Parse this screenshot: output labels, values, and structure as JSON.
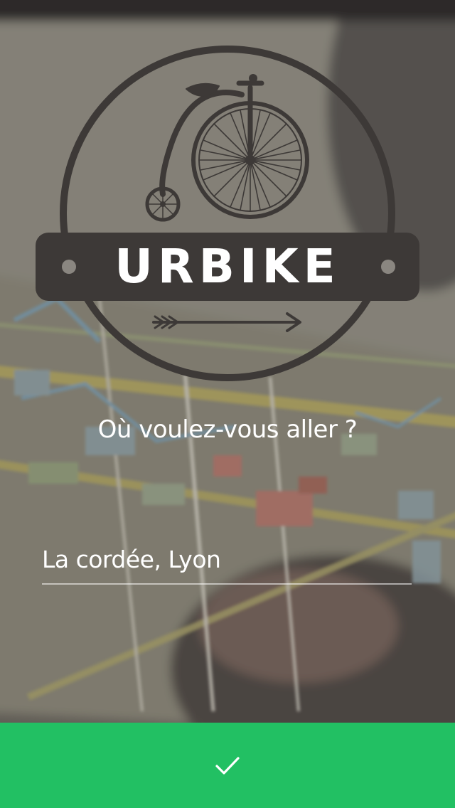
{
  "logo": {
    "wordmark": "URBIKE"
  },
  "prompt": {
    "question": "Où voulez-vous aller ?"
  },
  "destination": {
    "value": "La cordée, Lyon"
  },
  "confirm": {
    "icon": "checkmark-icon"
  },
  "colors": {
    "confirm_bar": "#22c063",
    "logo_dark": "#3d3937",
    "text": "#ffffff"
  }
}
